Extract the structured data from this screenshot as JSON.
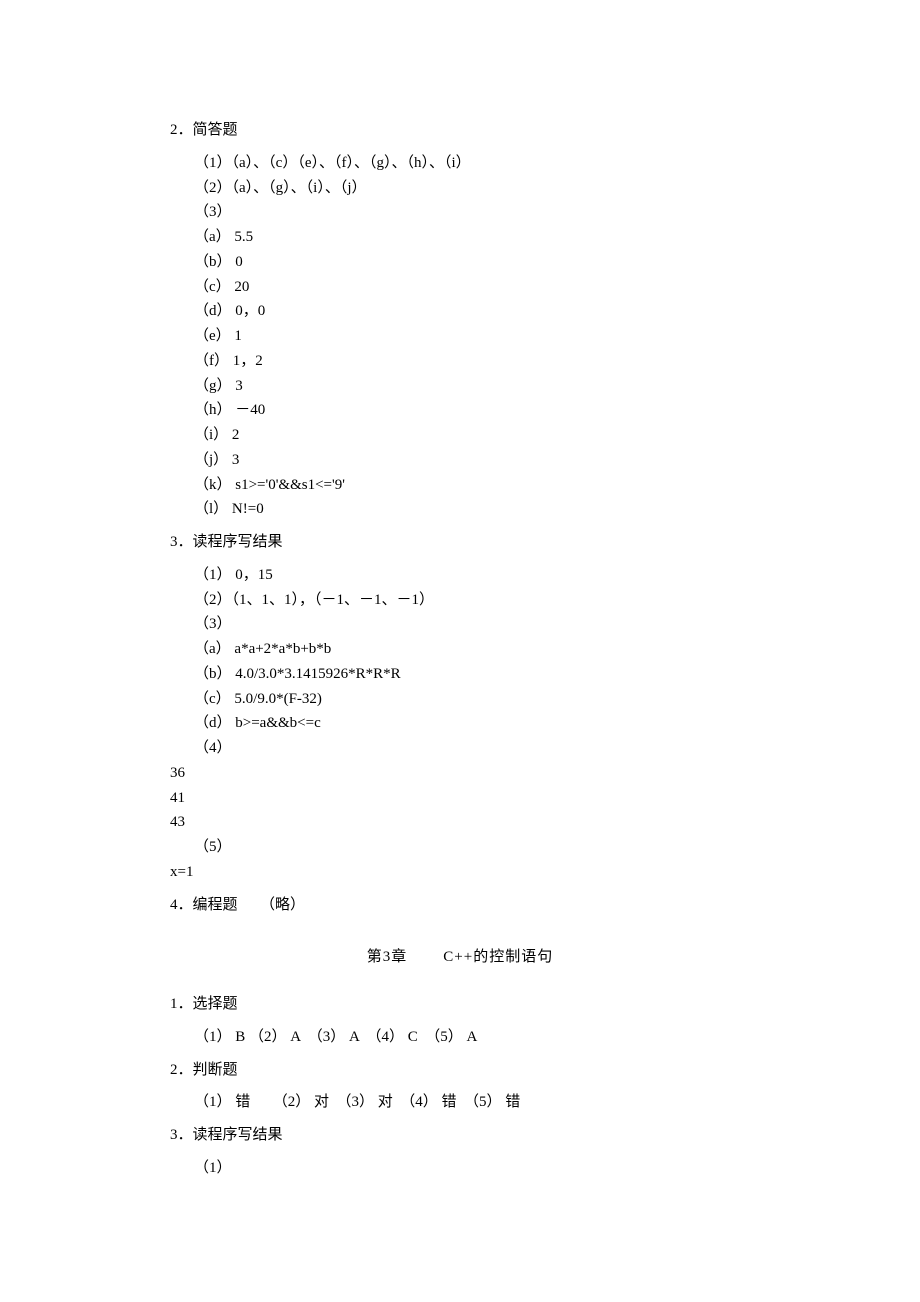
{
  "section2": {
    "title": "2．简答题",
    "lines": [
      "（1）（a）、（c）（e）、（f）、（g）、（h）、（i）",
      "（2）（a）、（g）、（i）、（j）",
      "（3）",
      "（a） 5.5",
      "（b） 0",
      "（c） 20",
      "（d） 0，0",
      "（e） 1",
      "（f） 1，2",
      "（g） 3",
      "（h） －40",
      "（i） 2",
      "（j） 3",
      "（k） s1>='0'&&s1<='9'",
      "（l） N!=0"
    ]
  },
  "section3": {
    "title": "3．读程序写结果",
    "lines_indent": [
      "（1） 0，15",
      "（2）（1、1、1），（－1、－1、－1）",
      "（3）",
      "（a） a*a+2*a*b+b*b",
      "（b） 4.0/3.0*3.1415926*R*R*R",
      "（c） 5.0/9.0*(F-32)",
      "（d） b>=a&&b<=c",
      "（4）"
    ],
    "lines_flush_a": [
      "36",
      "41",
      "43"
    ],
    "lines_indent2": [
      "（5）"
    ],
    "lines_flush_b": [
      "x=1"
    ]
  },
  "section4": {
    "title": "4．编程题　　（略）"
  },
  "chapter": {
    "left": "第3章",
    "right": "C++的控制语句"
  },
  "ch3_sec1": {
    "title": "1．选择题",
    "line": "（1） B （2） A　（3） A　（4） C　（5） A"
  },
  "ch3_sec2": {
    "title": "2．判断题",
    "line": "（1） 错　　（2） 对　（3） 对　（4） 错　（5） 错"
  },
  "ch3_sec3": {
    "title": "3．读程序写结果",
    "line": "（1）"
  }
}
